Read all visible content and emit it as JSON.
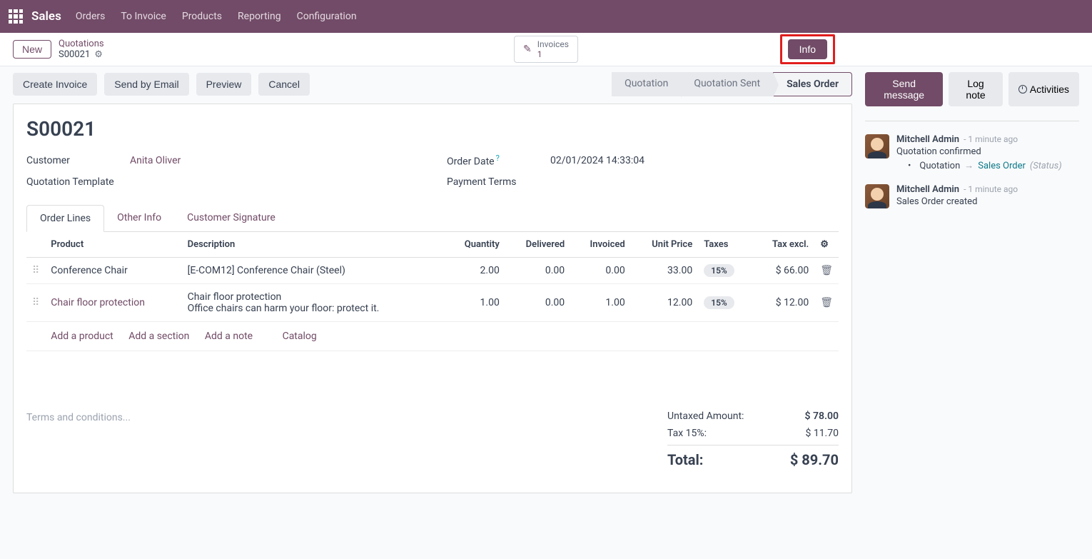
{
  "nav": {
    "brand": "Sales",
    "items": [
      "Orders",
      "To Invoice",
      "Products",
      "Reporting",
      "Configuration"
    ]
  },
  "subhead": {
    "new_btn": "New",
    "breadcrumb_top": "Quotations",
    "breadcrumb_record": "S00021",
    "stat_label": "Invoices",
    "stat_value": "1",
    "info_btn": "Info"
  },
  "actions": {
    "create_invoice": "Create Invoice",
    "send_email": "Send by Email",
    "preview": "Preview",
    "cancel": "Cancel"
  },
  "status": {
    "quotation": "Quotation",
    "quotation_sent": "Quotation Sent",
    "sales_order": "Sales Order"
  },
  "record": {
    "name": "S00021",
    "customer_label": "Customer",
    "customer_value": "Anita Oliver",
    "template_label": "Quotation Template",
    "order_date_label": "Order Date",
    "order_date_value": "02/01/2024 14:33:04",
    "payment_terms_label": "Payment Terms"
  },
  "tabs": {
    "order_lines": "Order Lines",
    "other_info": "Other Info",
    "customer_signature": "Customer Signature"
  },
  "table": {
    "headers": {
      "product": "Product",
      "description": "Description",
      "quantity": "Quantity",
      "delivered": "Delivered",
      "invoiced": "Invoiced",
      "unit_price": "Unit Price",
      "taxes": "Taxes",
      "tax_excl": "Tax excl."
    },
    "rows": [
      {
        "product": "Conference Chair",
        "description": "[E-COM12] Conference Chair (Steel)",
        "qty": "2.00",
        "delivered": "0.00",
        "invoiced": "0.00",
        "unit_price": "33.00",
        "tax": "15%",
        "subtotal": "$ 66.00"
      },
      {
        "product": "Chair floor protection",
        "description": "Chair floor protection\nOffice chairs can harm your floor: protect it.",
        "qty": "1.00",
        "delivered": "0.00",
        "invoiced": "1.00",
        "unit_price": "12.00",
        "tax": "15%",
        "subtotal": "$ 12.00"
      }
    ],
    "add_product": "Add a product",
    "add_section": "Add a section",
    "add_note": "Add a note",
    "catalog": "Catalog"
  },
  "terms_placeholder": "Terms and conditions...",
  "totals": {
    "untaxed_label": "Untaxed Amount:",
    "untaxed_value": "$ 78.00",
    "tax_label": "Tax 15%:",
    "tax_value": "$ 11.70",
    "total_label": "Total:",
    "total_value": "$ 89.70"
  },
  "chatter": {
    "send_message": "Send message",
    "log_note": "Log note",
    "activities": "Activities",
    "messages": [
      {
        "author": "Mitchell Admin",
        "time": "- 1 minute ago",
        "body": "Quotation confirmed",
        "bullet_from": "Quotation",
        "bullet_to": "Sales Order",
        "bullet_status": "(Status)"
      },
      {
        "author": "Mitchell Admin",
        "time": "- 1 minute ago",
        "body": "Sales Order created"
      }
    ]
  }
}
